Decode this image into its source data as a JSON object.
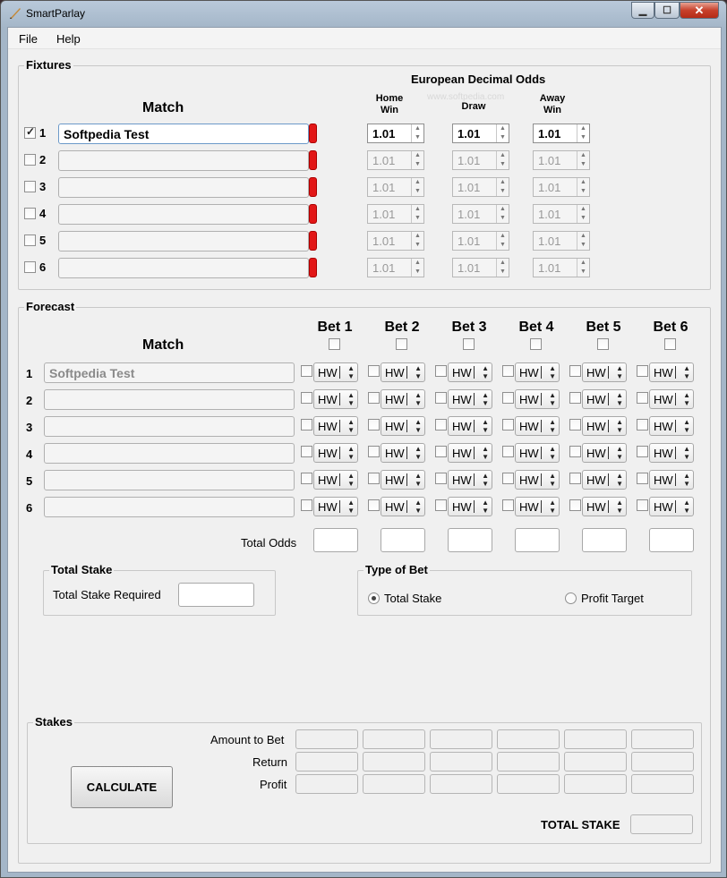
{
  "window": {
    "title": "SmartParlay"
  },
  "menu": {
    "file": "File",
    "help": "Help"
  },
  "fixtures": {
    "label": "Fixtures",
    "match_header": "Match",
    "odds_header": "European Decimal Odds",
    "watermark": "www.softpedia.com",
    "home_win": "Home Win",
    "draw": "Draw",
    "away_win": "Away Win",
    "rows": [
      {
        "num": "1",
        "checked": true,
        "match": "Softpedia Test",
        "home": "1.01",
        "draw": "1.01",
        "away": "1.01"
      },
      {
        "num": "2",
        "checked": false,
        "match": "",
        "home": "1.01",
        "draw": "1.01",
        "away": "1.01"
      },
      {
        "num": "3",
        "checked": false,
        "match": "",
        "home": "1.01",
        "draw": "1.01",
        "away": "1.01"
      },
      {
        "num": "4",
        "checked": false,
        "match": "",
        "home": "1.01",
        "draw": "1.01",
        "away": "1.01"
      },
      {
        "num": "5",
        "checked": false,
        "match": "",
        "home": "1.01",
        "draw": "1.01",
        "away": "1.01"
      },
      {
        "num": "6",
        "checked": false,
        "match": "",
        "home": "1.01",
        "draw": "1.01",
        "away": "1.01"
      }
    ]
  },
  "forecast": {
    "label": "Forecast",
    "match_header": "Match",
    "bets": [
      "Bet 1",
      "Bet 2",
      "Bet 3",
      "Bet 4",
      "Bet 5",
      "Bet 6"
    ],
    "combo_value": "HW",
    "rows": [
      {
        "num": "1",
        "match": "Softpedia Test"
      },
      {
        "num": "2",
        "match": ""
      },
      {
        "num": "3",
        "match": ""
      },
      {
        "num": "4",
        "match": ""
      },
      {
        "num": "5",
        "match": ""
      },
      {
        "num": "6",
        "match": ""
      }
    ],
    "total_odds_label": "Total Odds"
  },
  "total_stake": {
    "label": "Total Stake",
    "required_label": "Total Stake Required",
    "value": ""
  },
  "type_of_bet": {
    "label": "Type of Bet",
    "option1": "Total Stake",
    "option2": "Profit Target",
    "selected": "Total Stake"
  },
  "stakes": {
    "label": "Stakes",
    "amount_label": "Amount to Bet",
    "return_label": "Return",
    "profit_label": "Profit",
    "calculate": "CALCULATE",
    "total_stake_label": "TOTAL STAKE"
  }
}
